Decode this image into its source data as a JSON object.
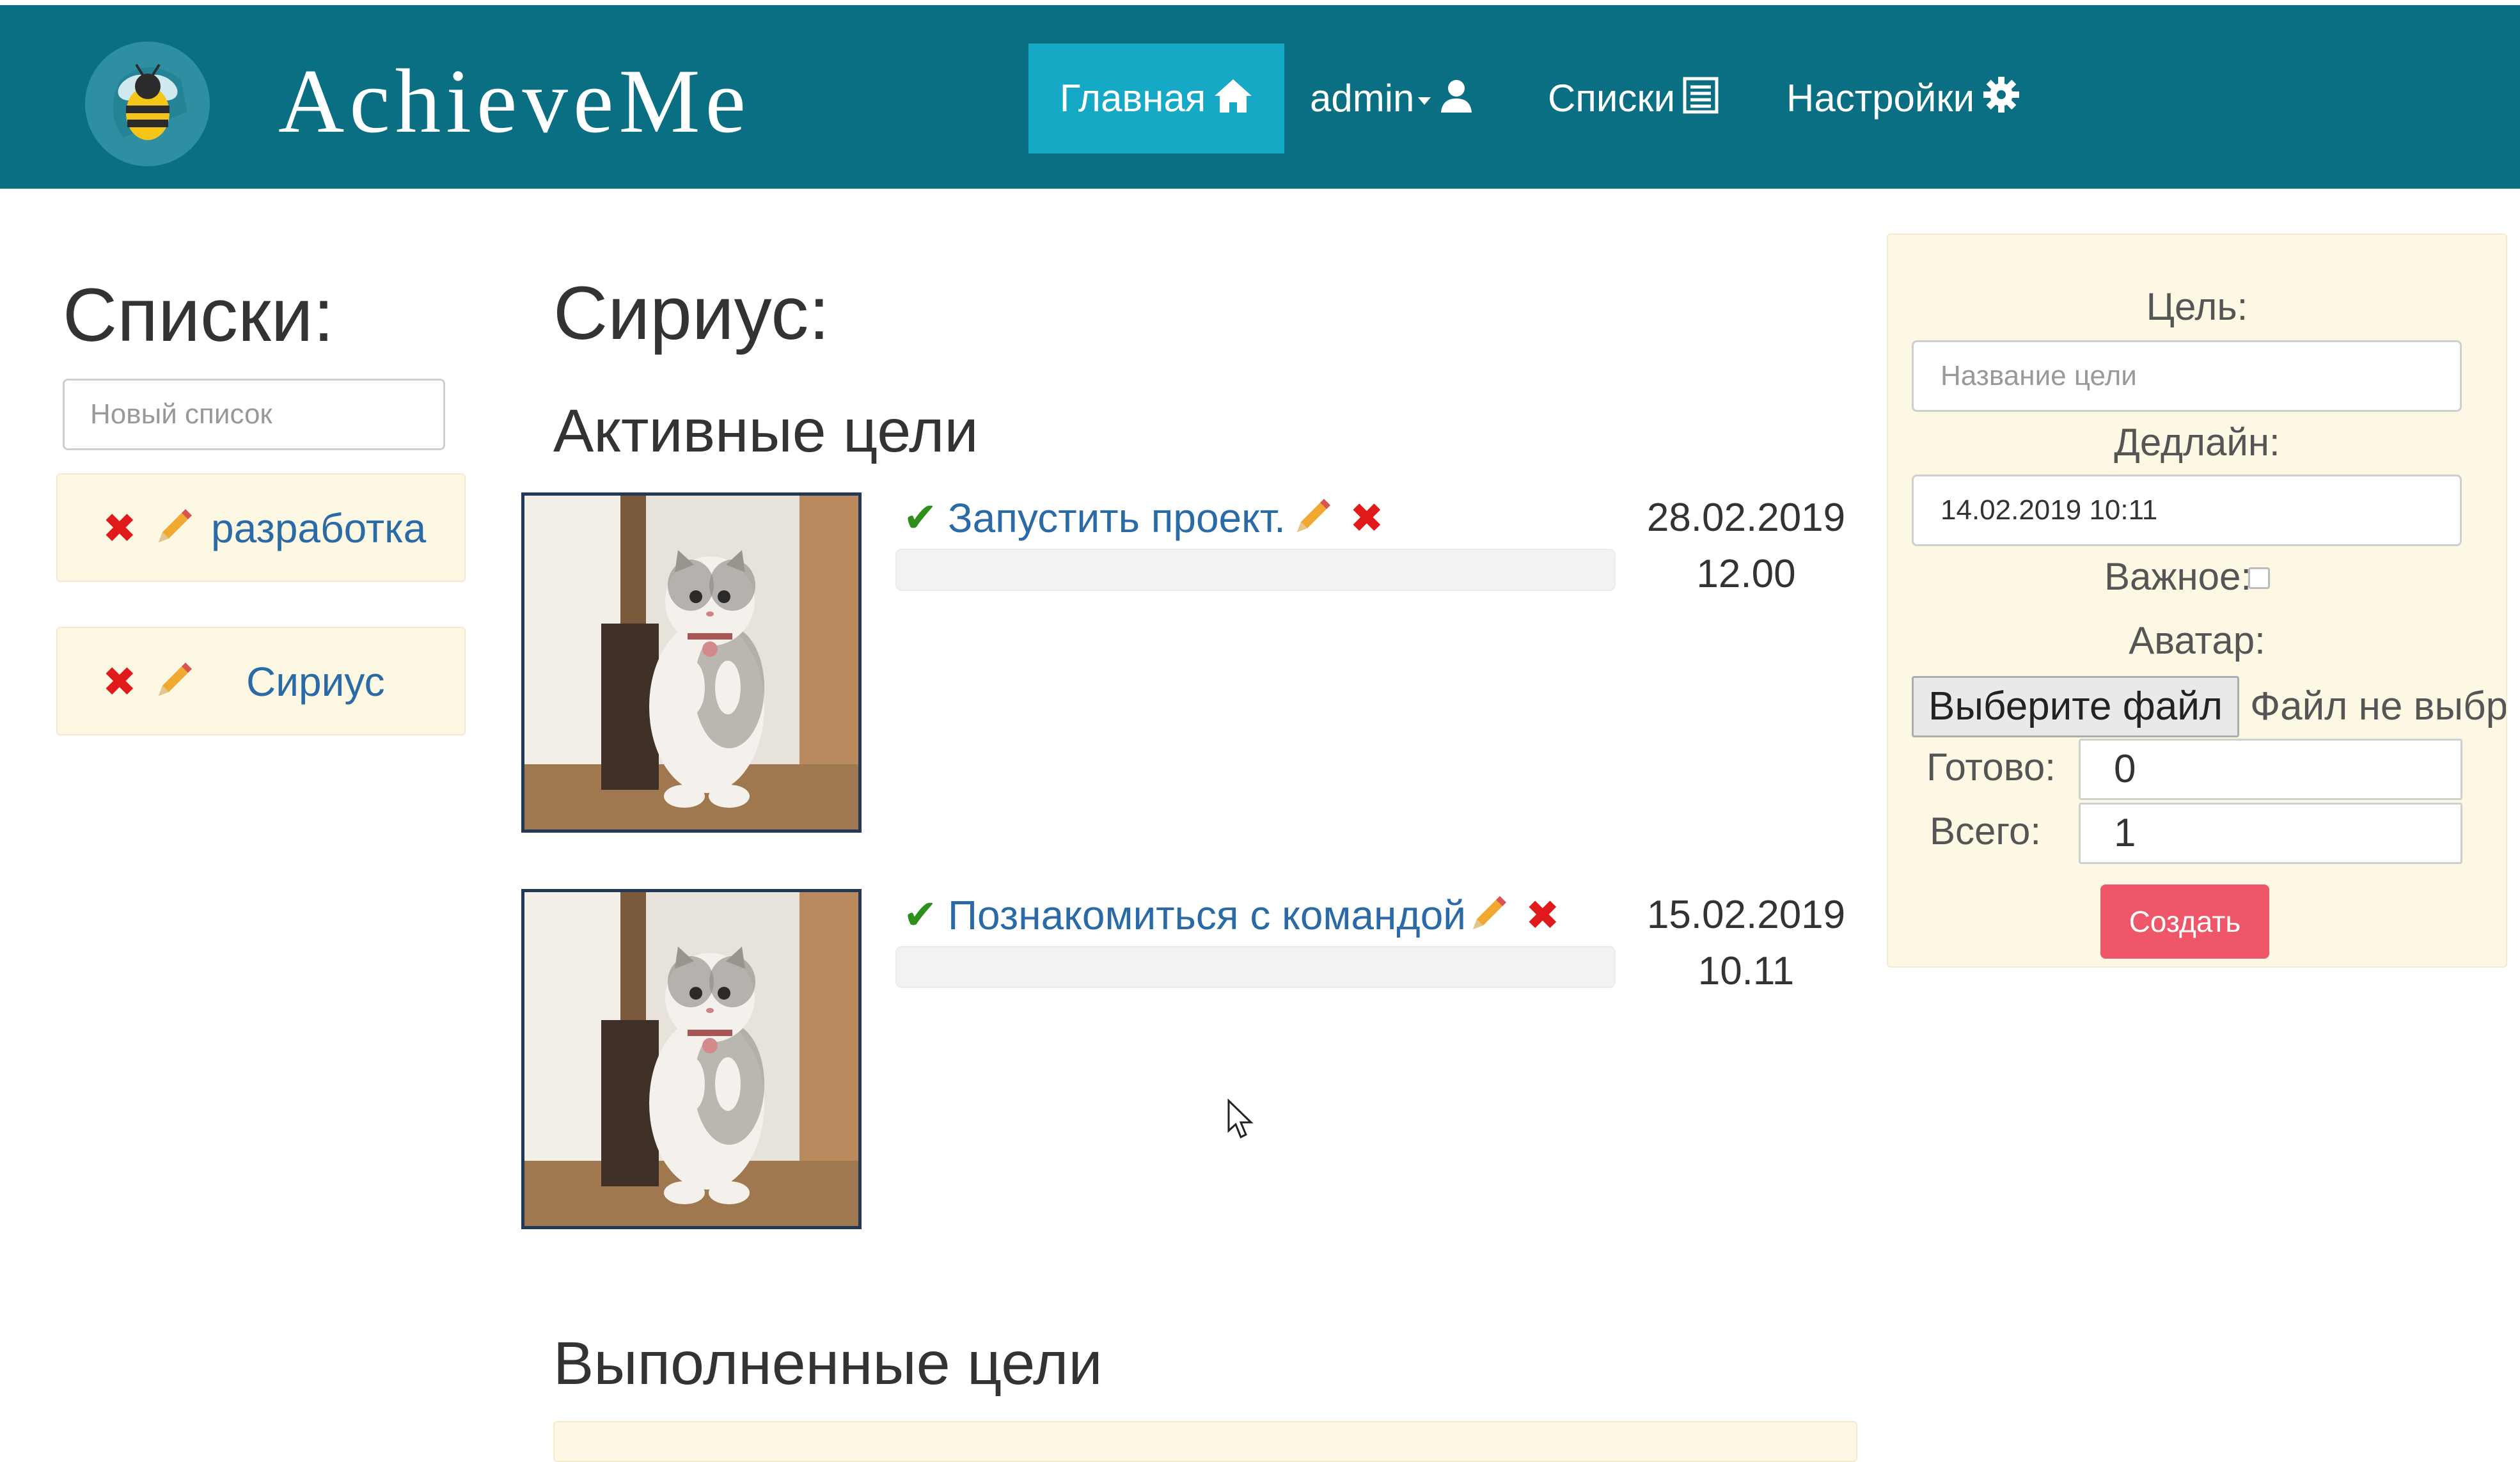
{
  "brand": {
    "name": "AchieveMe",
    "logo_icon": "bee-icon"
  },
  "nav": {
    "items": [
      {
        "label": "Главная",
        "icon": "home-icon",
        "active": true
      },
      {
        "label": "admin",
        "icon": "user-icon",
        "dropdown": true
      },
      {
        "label": "Списки",
        "icon": "list-icon"
      },
      {
        "label": "Настройки",
        "icon": "gear-icon"
      }
    ]
  },
  "lists": {
    "title": "Списки:",
    "new_placeholder": "Новый список",
    "items": [
      {
        "name": "разработка"
      },
      {
        "name": "Сириус"
      }
    ]
  },
  "main": {
    "list_title": "Сириус:",
    "active_title": "Активные цели",
    "done_title": "Выполненные цели",
    "goals": [
      {
        "title": "Запустить проект.",
        "date": "28.02.2019",
        "time": "12.00",
        "progress": 0
      },
      {
        "title": "Познакомиться с командой",
        "date": "15.02.2019",
        "time": "10.11",
        "progress": 0
      }
    ]
  },
  "form": {
    "goal_label": "Цель:",
    "goal_placeholder": "Название цели",
    "deadline_label": "Дедлайн:",
    "deadline_value": "14.02.2019 10:11",
    "important_label": "Важное:",
    "important_checked": false,
    "avatar_label": "Аватар:",
    "file_button": "Выберите файл",
    "file_status": "Файл не выбра",
    "done_label": "Готово:",
    "done_value": "0",
    "total_label": "Всего:",
    "total_value": "1",
    "create_button": "Создать"
  },
  "colors": {
    "navbar": "#0a6f83",
    "nav_active": "#16a9c5",
    "card_bg": "#fcf8e3",
    "link": "#2a6aa6",
    "delete": "#e01a1a",
    "check": "#2f8f1d",
    "create_button": "#f0566a"
  }
}
